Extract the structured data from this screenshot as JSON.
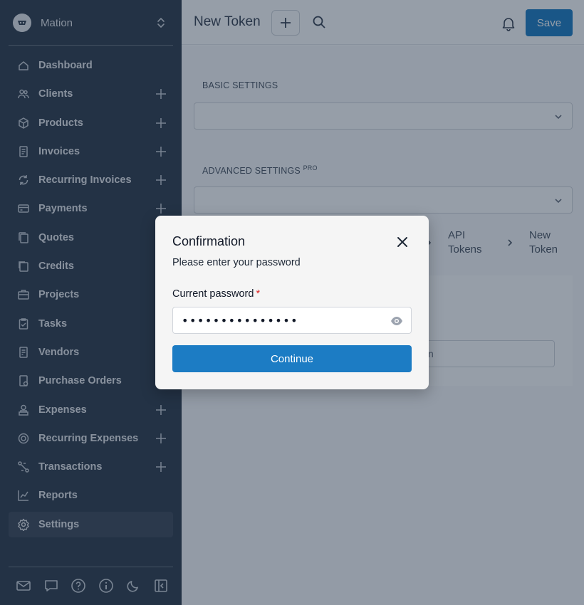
{
  "company": {
    "name": "Mation"
  },
  "sidebar": {
    "items": [
      {
        "label": "Dashboard",
        "plus": false
      },
      {
        "label": "Clients",
        "plus": true
      },
      {
        "label": "Products",
        "plus": true
      },
      {
        "label": "Invoices",
        "plus": true
      },
      {
        "label": "Recurring Invoices",
        "plus": true
      },
      {
        "label": "Payments",
        "plus": true
      },
      {
        "label": "Quotes",
        "plus": false
      },
      {
        "label": "Credits",
        "plus": false
      },
      {
        "label": "Projects",
        "plus": false
      },
      {
        "label": "Tasks",
        "plus": false
      },
      {
        "label": "Vendors",
        "plus": false
      },
      {
        "label": "Purchase Orders",
        "plus": false
      },
      {
        "label": "Expenses",
        "plus": true
      },
      {
        "label": "Recurring Expenses",
        "plus": true
      },
      {
        "label": "Transactions",
        "plus": true
      },
      {
        "label": "Reports",
        "plus": false
      },
      {
        "label": "Settings",
        "plus": false,
        "active": true
      }
    ],
    "bottom_icons": [
      "mail-icon",
      "chat-icon",
      "help-icon",
      "info-icon",
      "moon-icon",
      "collapse-icon"
    ]
  },
  "header": {
    "title": "New Token",
    "save_label": "Save"
  },
  "content": {
    "basic_settings_label": "BASIC SETTINGS",
    "advanced_settings_label": "ADVANCED SETTINGS",
    "advanced_pro_badge": "PRO",
    "breadcrumb": [
      "API Tokens",
      "New Token"
    ],
    "card_input_partial": "n"
  },
  "modal": {
    "title": "Confirmation",
    "subtitle": "Please enter your password",
    "password_label": "Current password",
    "required_mark": "*",
    "password_value": "•••••••••••••••",
    "continue_label": "Continue"
  },
  "colors": {
    "sidebar_bg": "#2f3b4c",
    "accent": "#1c7cc4",
    "required": "#dc2626",
    "overlay": "rgba(22,39,63,0.45)"
  }
}
